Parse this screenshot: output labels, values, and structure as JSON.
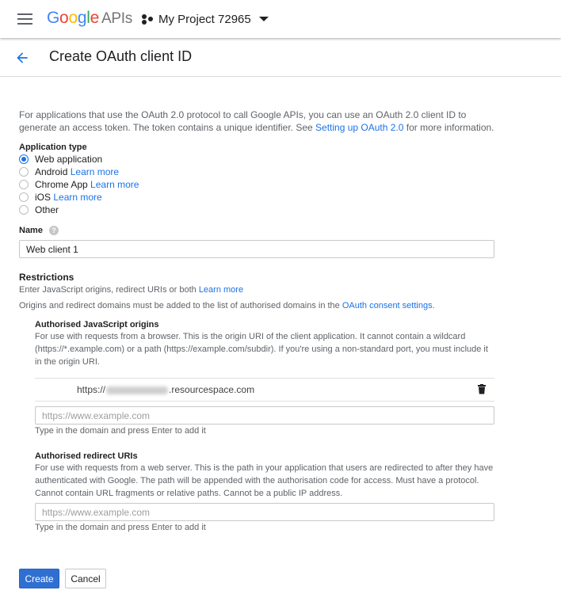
{
  "topbar": {
    "logo": {
      "g1": "G",
      "o1": "o",
      "o2": "o",
      "g2": "g",
      "l": "l",
      "e": "e",
      "apis": "APIs"
    },
    "project_name": "My Project 72965",
    "icons": {
      "menu": "hamburger-icon",
      "project": "project-dots-icon",
      "dropdown": "caret-down-icon"
    }
  },
  "subheader": {
    "title": "Create OAuth client ID",
    "back_icon": "arrow-back-icon"
  },
  "intro": {
    "text_before": "For applications that use the OAuth 2.0 protocol to call Google APIs, you can use an OAuth 2.0 client ID to generate an access token. The token contains a unique identifier. See ",
    "link": "Setting up OAuth 2.0",
    "text_after": " for more information."
  },
  "application_type": {
    "label": "Application type",
    "options": [
      {
        "label": "Web application",
        "link": "",
        "checked": true
      },
      {
        "label": "Android",
        "link": "Learn more",
        "checked": false
      },
      {
        "label": "Chrome App",
        "link": "Learn more",
        "checked": false
      },
      {
        "label": "iOS",
        "link": "Learn more",
        "checked": false
      },
      {
        "label": "Other",
        "link": "",
        "checked": false
      }
    ]
  },
  "name": {
    "label": "Name",
    "help": "?",
    "value": "Web client 1"
  },
  "restrictions": {
    "label": "Restrictions",
    "line1_text": "Enter JavaScript origins, redirect URIs or both ",
    "line1_link": "Learn more",
    "line2_text": "Origins and redirect domains must be added to the list of authorised domains in the ",
    "line2_link": "OAuth consent settings",
    "line2_end": "."
  },
  "js_origins": {
    "label": "Authorised JavaScript origins",
    "description": "For use with requests from a browser. This is the origin URI of the client application. It cannot contain a wildcard (https://*.example.com) or a path (https://example.com/subdir). If you're using a non-standard port, you must include it in the origin URI.",
    "entry_prefix": "https://",
    "entry_blurred": "andywebb.trial",
    "entry_suffix": ".resourcespace.com",
    "delete_icon": "trash-icon",
    "placeholder": "https://www.example.com",
    "hint": "Type in the domain and press Enter to add it"
  },
  "redirect_uris": {
    "label": "Authorised redirect URIs",
    "description": "For use with requests from a web server. This is the path in your application that users are redirected to after they have authenticated with Google. The path will be appended with the authorisation code for access. Must have a protocol. Cannot contain URL fragments or relative paths. Cannot be a public IP address.",
    "placeholder": "https://www.example.com",
    "hint": "Type in the domain and press Enter to add it"
  },
  "actions": {
    "create": "Create",
    "cancel": "Cancel"
  },
  "colors": {
    "accent": "#1a73e8",
    "primary_button": "#2f6fd1"
  }
}
